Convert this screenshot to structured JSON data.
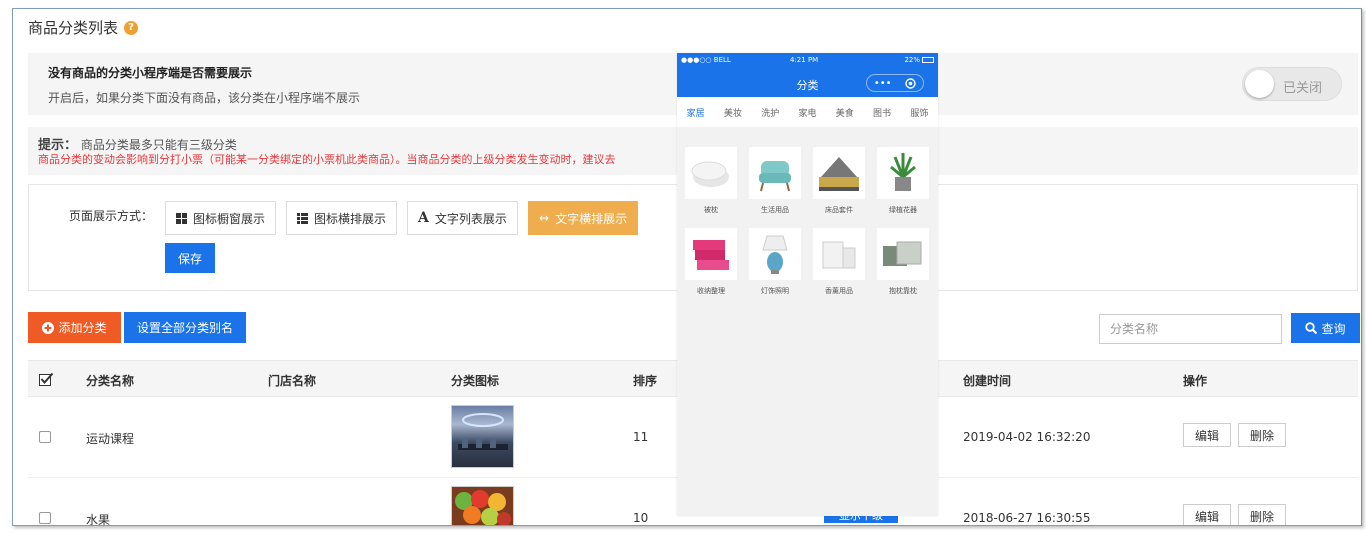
{
  "page": {
    "title": "商品分类列表",
    "help_icon": "?"
  },
  "setting": {
    "heading": "没有商品的分类小程序端是否需要展示",
    "desc": "开启后，如果分类下面没有商品，该分类在小程序端不展示",
    "toggle_label": "已关闭",
    "toggle_state": false
  },
  "tip": {
    "label": "提示：",
    "line1": "商品分类最多只能有三级分类",
    "line2": "商品分类的变动会影响到分打小票（可能某一分类绑定的小票机此类商品）。当商品分类的上级分类发生变动时，建议去"
  },
  "display": {
    "label": "页面展示方式：",
    "modes": [
      {
        "label": "图标橱窗展示",
        "icon": "grid-icon",
        "active": false
      },
      {
        "label": "图标横排展示",
        "icon": "list-icon",
        "active": false
      },
      {
        "label": "文字列表展示",
        "icon": "text-icon",
        "glyph": "A",
        "active": false
      },
      {
        "label": "文字横排展示",
        "icon": "arrows-icon",
        "glyph": "↔",
        "active": true
      }
    ],
    "save_label": "保存"
  },
  "toolbar": {
    "add_label": "添加分类",
    "alias_label": "设置全部分类别名",
    "search_placeholder": "分类名称",
    "search_label": "查询"
  },
  "table": {
    "headers": {
      "name": "分类名称",
      "store": "门店名称",
      "icon": "分类图标",
      "sort": "排序",
      "created": "创建时间",
      "ops": "操作"
    },
    "rows": [
      {
        "name": "运动课程",
        "store": "",
        "sort": "11",
        "created": "2019-04-02 16:32:20",
        "edit": "编辑",
        "delete": "删除"
      },
      {
        "name": "水果",
        "store": "",
        "sort": "10",
        "created": "2018-06-27 16:30:55",
        "edit": "编辑",
        "delete": "删除",
        "badge": "显示下级"
      }
    ]
  },
  "phone": {
    "carrier": "●●●○○ BELL",
    "time": "4:21 PM",
    "battery": "22%",
    "title": "分类",
    "capsule": "•••",
    "tabs": [
      "家居",
      "美妆",
      "洗护",
      "家电",
      "美食",
      "图书",
      "服饰"
    ],
    "items": [
      "被枕",
      "生活用品",
      "床品套件",
      "绿植花器",
      "收纳整理",
      "灯饰照明",
      "香薰用品",
      "抱枕靠枕"
    ]
  },
  "colors": {
    "primary": "#1a73e8",
    "orange": "#f05a24",
    "active_mode": "#f0ad4e",
    "warning_text": "#e4393c"
  }
}
